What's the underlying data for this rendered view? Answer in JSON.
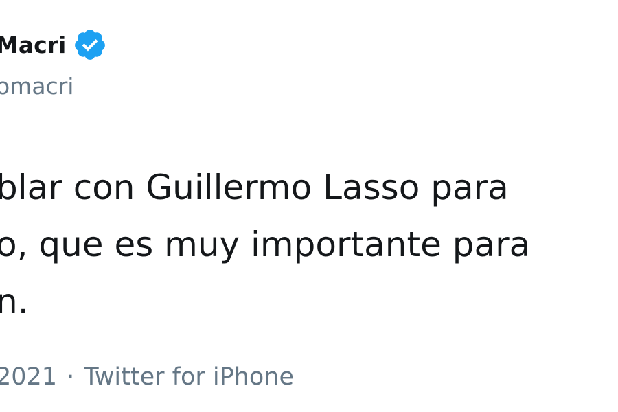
{
  "tweet": {
    "display_name": "Macri",
    "handle": "omacri",
    "verified": true,
    "body_lines": [
      "blar con Guillermo Lasso para",
      "o, que es muy importante para",
      "n."
    ],
    "date": "2021",
    "separator": "·",
    "source": "Twitter for iPhone"
  },
  "colors": {
    "verified_badge": "#1da1f2",
    "secondary_text": "#657786",
    "primary_text": "#14171a"
  },
  "icons": {
    "verified": "verified-badge-icon"
  }
}
